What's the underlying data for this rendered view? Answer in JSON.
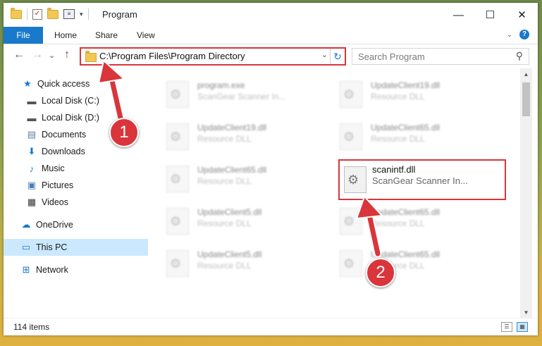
{
  "window": {
    "title": "Program"
  },
  "quick_access_toolbar": {
    "dropdown_glyph": "▾"
  },
  "window_controls": {
    "minimize": "—",
    "maximize": "☐",
    "close": "✕"
  },
  "ribbon": {
    "tabs": [
      {
        "label": "File",
        "active": true
      },
      {
        "label": "Home"
      },
      {
        "label": "Share"
      },
      {
        "label": "View"
      }
    ],
    "collapse_glyph": "⌄",
    "help_glyph": "?"
  },
  "navigation": {
    "back": "←",
    "forward": "→",
    "recent": "⌄",
    "up": "↑",
    "address": "C:\\Program Files\\Program Directory",
    "address_dropdown": "⌄",
    "refresh": "↻",
    "search_placeholder": "Search Program",
    "search_glyph": "⚲"
  },
  "sidebar": {
    "items": [
      {
        "label": "Quick access",
        "icon": "star-icon",
        "glyph": "★",
        "color": "#1979ca"
      },
      {
        "label": "Local Disk (C:)",
        "icon": "drive-icon",
        "glyph": "▬",
        "color": "#555555",
        "pinned": true
      },
      {
        "label": "Local Disk (D:)",
        "icon": "drive-icon",
        "glyph": "▬",
        "color": "#555555",
        "pinned": true
      },
      {
        "label": "Documents",
        "icon": "document-icon",
        "glyph": "▤",
        "color": "#5a7fa8",
        "pinned": true
      },
      {
        "label": "Downloads",
        "icon": "download-icon",
        "glyph": "⬇",
        "color": "#1979ca",
        "pinned": true
      },
      {
        "label": "Music",
        "icon": "music-icon",
        "glyph": "♪",
        "color": "#1979ca",
        "pinned": true
      },
      {
        "label": "Pictures",
        "icon": "picture-icon",
        "glyph": "▣",
        "color": "#4a7cb5",
        "pinned": true
      },
      {
        "label": "Videos",
        "icon": "video-icon",
        "glyph": "▦",
        "color": "#333333",
        "pinned": true
      },
      {
        "label": "OneDrive",
        "icon": "cloud-icon",
        "glyph": "☁",
        "color": "#1979ca"
      },
      {
        "label": "This PC",
        "icon": "computer-icon",
        "glyph": "▭",
        "color": "#1979ca",
        "selected": true
      },
      {
        "label": "Network",
        "icon": "network-icon",
        "glyph": "⊞",
        "color": "#1979ca"
      }
    ],
    "pin_glyph": "📌"
  },
  "files": {
    "left_column": [
      {
        "name": "program.exe",
        "desc": "ScanGear Scanner In..."
      },
      {
        "name": "UpdateClient19.dll",
        "desc": "Resource DLL"
      },
      {
        "name": "UpdateClient65.dll",
        "desc": "Resource DLL"
      },
      {
        "name": "UpdateClient5.dll",
        "desc": "Resource DLL"
      },
      {
        "name": "UpdateClient5.dll",
        "desc": "Resource DLL"
      }
    ],
    "right_column": [
      {
        "name": "UpdateClient19.dll",
        "desc": "Resource DLL"
      },
      {
        "name": "UpdateClient65.dll",
        "desc": "Resource DLL"
      },
      {
        "name": "UpdateClient65.dll",
        "desc": "Resource DLL"
      },
      {
        "name": "UpdateClient65.dll",
        "desc": "Resource DLL"
      }
    ],
    "highlighted": {
      "name": "scanintf.dll",
      "desc": "ScanGear Scanner In..."
    }
  },
  "scrollbar": {
    "up": "▲",
    "down": "▼"
  },
  "status": {
    "item_count": "114 items"
  },
  "view_buttons": {
    "details": "☰",
    "tiles": "▦"
  },
  "annotations": [
    {
      "number": "1",
      "color": "#d9353b"
    },
    {
      "number": "2",
      "color": "#d9353b"
    }
  ]
}
